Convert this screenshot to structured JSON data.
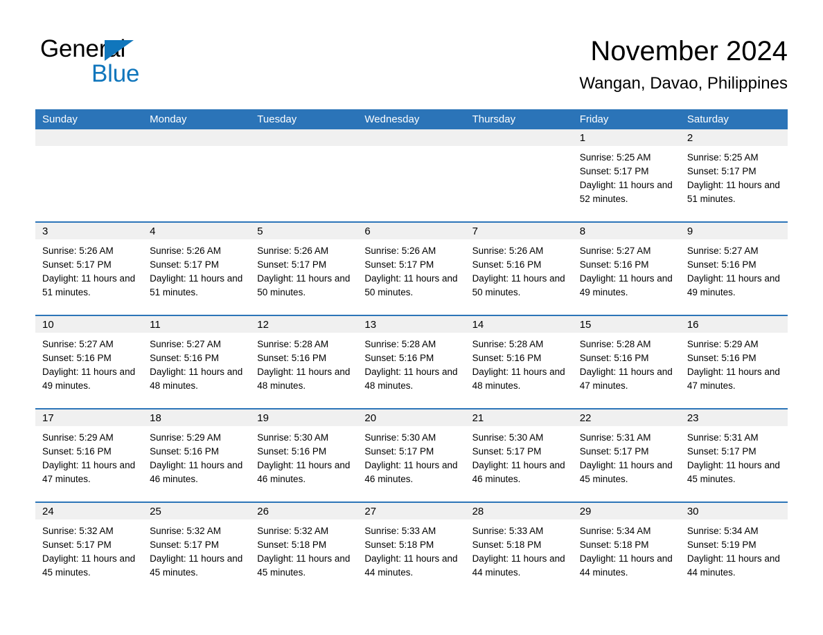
{
  "brand": {
    "line1": "General",
    "line2": "Blue",
    "triangle_icon": "triangle-icon",
    "accent_color": "#1076bc"
  },
  "header": {
    "month_title": "November 2024",
    "location": "Wangan, Davao, Philippines"
  },
  "theme": {
    "header_blue": "#2b74b8",
    "daynum_band": "#f0f0f0",
    "text": "#000000"
  },
  "calendar": {
    "weekdays": [
      "Sunday",
      "Monday",
      "Tuesday",
      "Wednesday",
      "Thursday",
      "Friday",
      "Saturday"
    ],
    "weeks": [
      [
        {
          "day": "",
          "lines": []
        },
        {
          "day": "",
          "lines": []
        },
        {
          "day": "",
          "lines": []
        },
        {
          "day": "",
          "lines": []
        },
        {
          "day": "",
          "lines": []
        },
        {
          "day": "1",
          "lines": [
            "Sunrise: 5:25 AM",
            "Sunset: 5:17 PM",
            "Daylight: 11 hours and 52 minutes."
          ]
        },
        {
          "day": "2",
          "lines": [
            "Sunrise: 5:25 AM",
            "Sunset: 5:17 PM",
            "Daylight: 11 hours and 51 minutes."
          ]
        }
      ],
      [
        {
          "day": "3",
          "lines": [
            "Sunrise: 5:26 AM",
            "Sunset: 5:17 PM",
            "Daylight: 11 hours and 51 minutes."
          ]
        },
        {
          "day": "4",
          "lines": [
            "Sunrise: 5:26 AM",
            "Sunset: 5:17 PM",
            "Daylight: 11 hours and 51 minutes."
          ]
        },
        {
          "day": "5",
          "lines": [
            "Sunrise: 5:26 AM",
            "Sunset: 5:17 PM",
            "Daylight: 11 hours and 50 minutes."
          ]
        },
        {
          "day": "6",
          "lines": [
            "Sunrise: 5:26 AM",
            "Sunset: 5:17 PM",
            "Daylight: 11 hours and 50 minutes."
          ]
        },
        {
          "day": "7",
          "lines": [
            "Sunrise: 5:26 AM",
            "Sunset: 5:16 PM",
            "Daylight: 11 hours and 50 minutes."
          ]
        },
        {
          "day": "8",
          "lines": [
            "Sunrise: 5:27 AM",
            "Sunset: 5:16 PM",
            "Daylight: 11 hours and 49 minutes."
          ]
        },
        {
          "day": "9",
          "lines": [
            "Sunrise: 5:27 AM",
            "Sunset: 5:16 PM",
            "Daylight: 11 hours and 49 minutes."
          ]
        }
      ],
      [
        {
          "day": "10",
          "lines": [
            "Sunrise: 5:27 AM",
            "Sunset: 5:16 PM",
            "Daylight: 11 hours and 49 minutes."
          ]
        },
        {
          "day": "11",
          "lines": [
            "Sunrise: 5:27 AM",
            "Sunset: 5:16 PM",
            "Daylight: 11 hours and 48 minutes."
          ]
        },
        {
          "day": "12",
          "lines": [
            "Sunrise: 5:28 AM",
            "Sunset: 5:16 PM",
            "Daylight: 11 hours and 48 minutes."
          ]
        },
        {
          "day": "13",
          "lines": [
            "Sunrise: 5:28 AM",
            "Sunset: 5:16 PM",
            "Daylight: 11 hours and 48 minutes."
          ]
        },
        {
          "day": "14",
          "lines": [
            "Sunrise: 5:28 AM",
            "Sunset: 5:16 PM",
            "Daylight: 11 hours and 48 minutes."
          ]
        },
        {
          "day": "15",
          "lines": [
            "Sunrise: 5:28 AM",
            "Sunset: 5:16 PM",
            "Daylight: 11 hours and 47 minutes."
          ]
        },
        {
          "day": "16",
          "lines": [
            "Sunrise: 5:29 AM",
            "Sunset: 5:16 PM",
            "Daylight: 11 hours and 47 minutes."
          ]
        }
      ],
      [
        {
          "day": "17",
          "lines": [
            "Sunrise: 5:29 AM",
            "Sunset: 5:16 PM",
            "Daylight: 11 hours and 47 minutes."
          ]
        },
        {
          "day": "18",
          "lines": [
            "Sunrise: 5:29 AM",
            "Sunset: 5:16 PM",
            "Daylight: 11 hours and 46 minutes."
          ]
        },
        {
          "day": "19",
          "lines": [
            "Sunrise: 5:30 AM",
            "Sunset: 5:16 PM",
            "Daylight: 11 hours and 46 minutes."
          ]
        },
        {
          "day": "20",
          "lines": [
            "Sunrise: 5:30 AM",
            "Sunset: 5:17 PM",
            "Daylight: 11 hours and 46 minutes."
          ]
        },
        {
          "day": "21",
          "lines": [
            "Sunrise: 5:30 AM",
            "Sunset: 5:17 PM",
            "Daylight: 11 hours and 46 minutes."
          ]
        },
        {
          "day": "22",
          "lines": [
            "Sunrise: 5:31 AM",
            "Sunset: 5:17 PM",
            "Daylight: 11 hours and 45 minutes."
          ]
        },
        {
          "day": "23",
          "lines": [
            "Sunrise: 5:31 AM",
            "Sunset: 5:17 PM",
            "Daylight: 11 hours and 45 minutes."
          ]
        }
      ],
      [
        {
          "day": "24",
          "lines": [
            "Sunrise: 5:32 AM",
            "Sunset: 5:17 PM",
            "Daylight: 11 hours and 45 minutes."
          ]
        },
        {
          "day": "25",
          "lines": [
            "Sunrise: 5:32 AM",
            "Sunset: 5:17 PM",
            "Daylight: 11 hours and 45 minutes."
          ]
        },
        {
          "day": "26",
          "lines": [
            "Sunrise: 5:32 AM",
            "Sunset: 5:18 PM",
            "Daylight: 11 hours and 45 minutes."
          ]
        },
        {
          "day": "27",
          "lines": [
            "Sunrise: 5:33 AM",
            "Sunset: 5:18 PM",
            "Daylight: 11 hours and 44 minutes."
          ]
        },
        {
          "day": "28",
          "lines": [
            "Sunrise: 5:33 AM",
            "Sunset: 5:18 PM",
            "Daylight: 11 hours and 44 minutes."
          ]
        },
        {
          "day": "29",
          "lines": [
            "Sunrise: 5:34 AM",
            "Sunset: 5:18 PM",
            "Daylight: 11 hours and 44 minutes."
          ]
        },
        {
          "day": "30",
          "lines": [
            "Sunrise: 5:34 AM",
            "Sunset: 5:19 PM",
            "Daylight: 11 hours and 44 minutes."
          ]
        }
      ]
    ]
  }
}
